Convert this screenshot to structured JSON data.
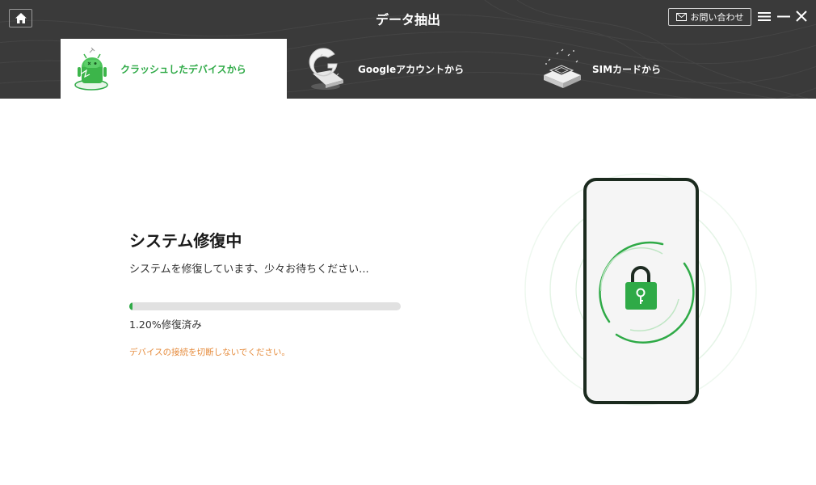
{
  "header": {
    "title": "データ抽出",
    "contact_label": "お問い合わせ",
    "icons": {
      "home": "home-icon",
      "mail": "mail-icon",
      "menu": "menu-icon",
      "minimize": "minimize-icon",
      "close": "close-icon"
    }
  },
  "tabs": [
    {
      "label": "クラッシュしたデバイスから",
      "icon": "crashed-android-icon",
      "active": true
    },
    {
      "label": "Googleアカウントから",
      "icon": "google-account-icon",
      "active": false
    },
    {
      "label": "SIMカードから",
      "icon": "sim-card-icon",
      "active": false
    }
  ],
  "main": {
    "title": "システム修復中",
    "subtitle": "システムを修復しています、少々お待ちください...",
    "progress_percent": 1.2,
    "progress_label": "1.20%修復済み",
    "warning": "デバイスの接続を切断しないでください。",
    "illustration_icon": "phone-lock-icon"
  },
  "colors": {
    "accent": "#2faa47",
    "header_bg": "#3a3a3a",
    "warning": "#e58a3a",
    "track": "#e1e1e1"
  }
}
